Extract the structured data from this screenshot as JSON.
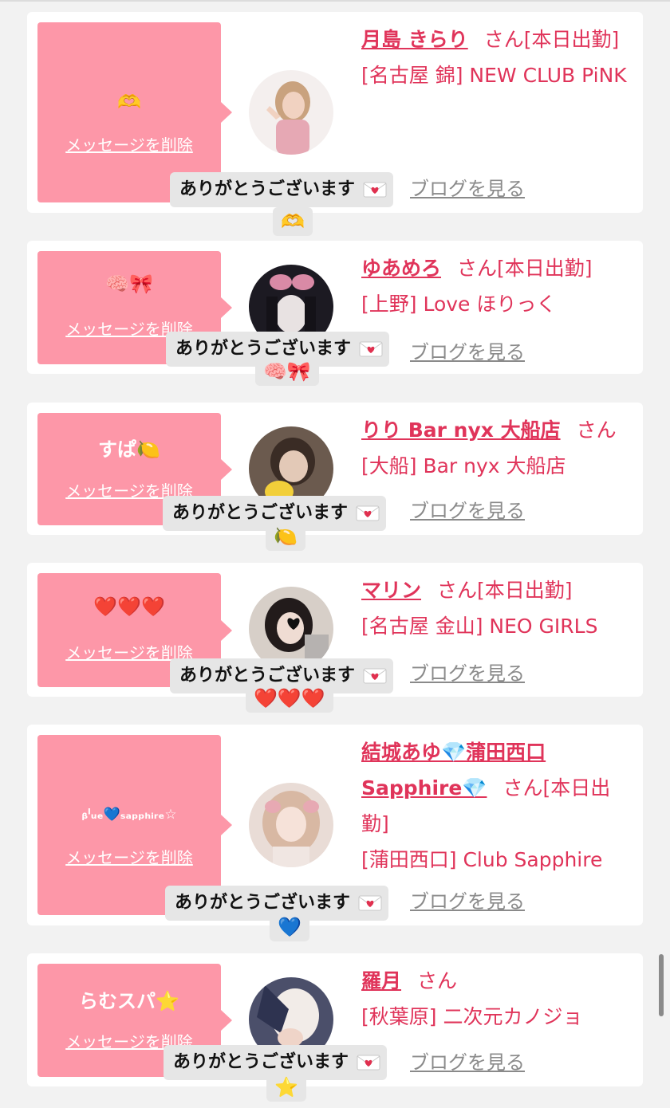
{
  "delete_label": "メッセージを削除",
  "honorific": "さん",
  "reply_text": "ありがとうございます",
  "blog_link_full": "のブログを見る",
  "blog_link_visible": "ブログを見る",
  "cards": [
    {
      "message": "🫶",
      "name": "月島 きらり",
      "status": "[本日出勤]",
      "work": "[名古屋 錦] NEW CLUB PiNK",
      "reply_emoji": "🫶"
    },
    {
      "message": "🧠🎀",
      "name": "ゆあめろ",
      "status": "[本日出勤]",
      "work": "[上野] Love ほりっく",
      "reply_emoji": "🧠🎀"
    },
    {
      "message": "すぱ🍋",
      "name": "りり Bar nyx 大船店",
      "status": "",
      "work": "[大船] Bar nyx 大船店",
      "reply_emoji": "🍋"
    },
    {
      "message": "❤️❤️❤️",
      "name": "マリン",
      "status": "[本日出勤]",
      "work": "[名古屋 金山] NEO GIRLS",
      "reply_emoji": "❤️❤️❤️"
    },
    {
      "message": "ᵦˡᵤₑ💙ₛₐₚₚₕᵢᵣₑ☆",
      "name": "結城あゆ💎蒲田西口Sapphire💎",
      "status": "[本日出勤]",
      "work": "[蒲田西口] Club Sapphire",
      "reply_emoji": "💙"
    },
    {
      "message": "らむスパ⭐️",
      "name": "羅月",
      "status": "",
      "work": "[秋葉原] 二次元カノジョ",
      "reply_emoji": "⭐️"
    }
  ]
}
